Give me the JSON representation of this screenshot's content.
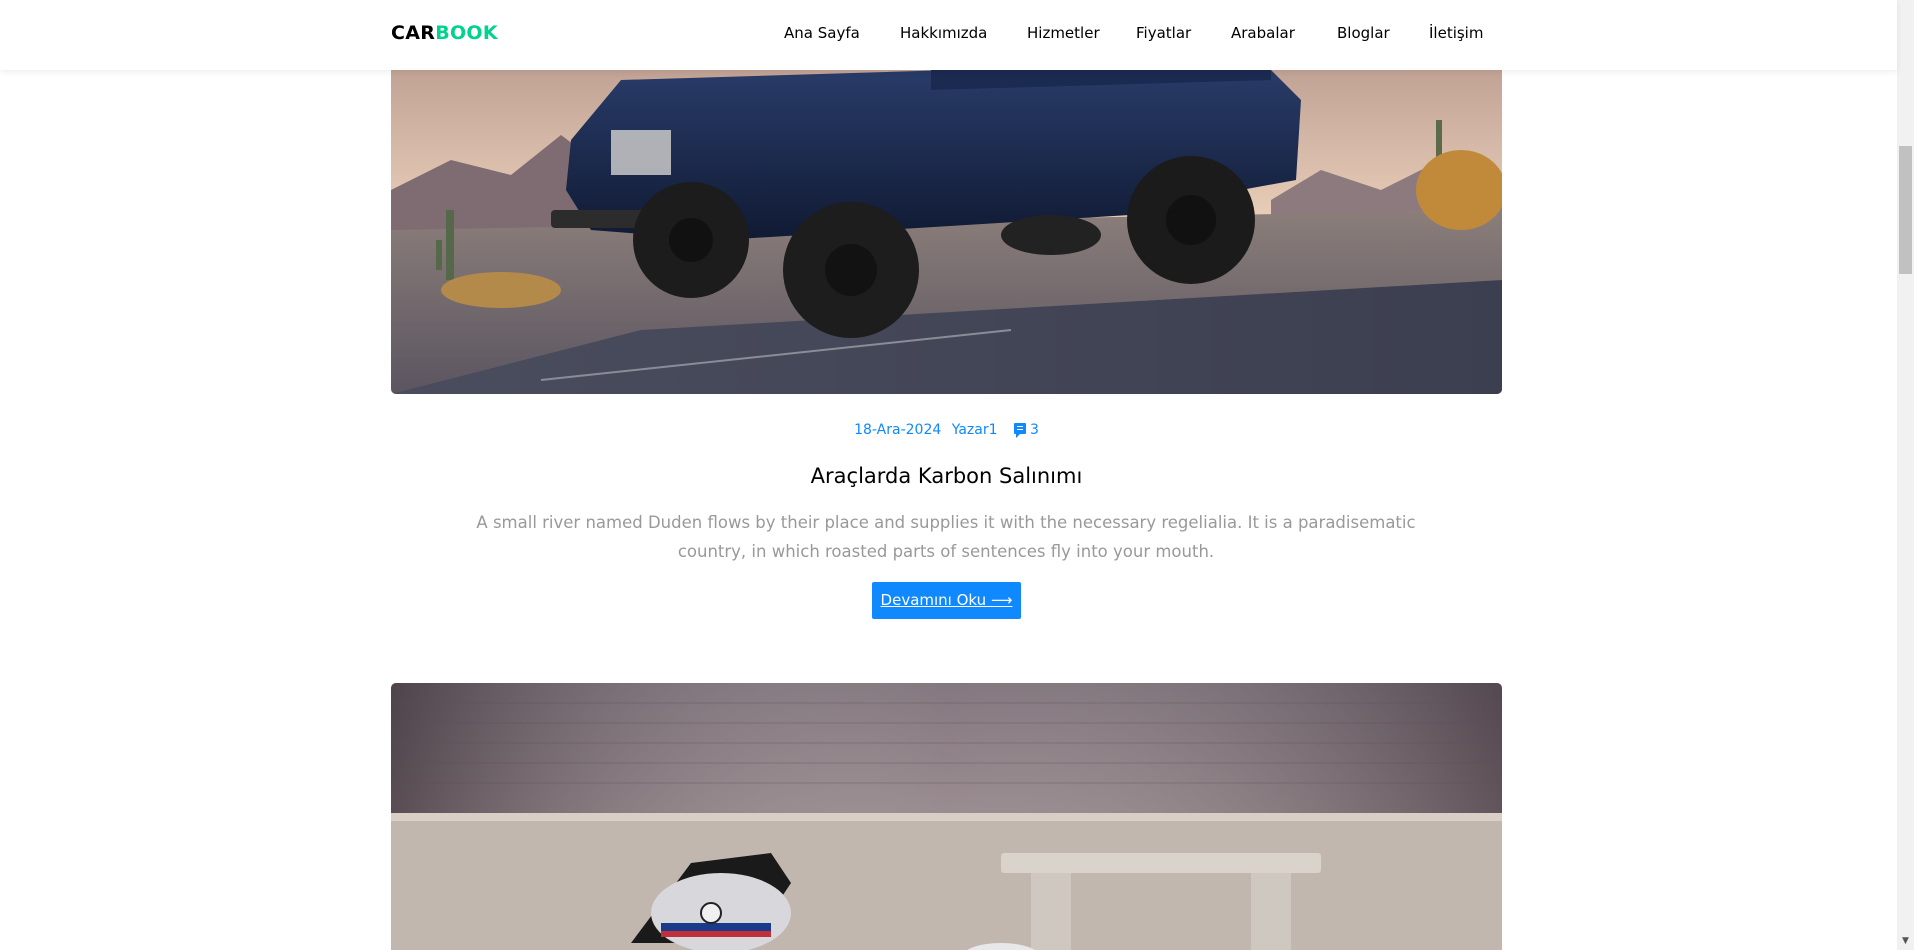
{
  "brand": {
    "part1": "CAR",
    "part2": "BOOK"
  },
  "nav": [
    {
      "label": "Ana Sayfa"
    },
    {
      "label": "Hakkımızda"
    },
    {
      "label": "Hizmetler"
    },
    {
      "label": "Fiyatlar"
    },
    {
      "label": "Arabalar"
    },
    {
      "label": "Bloglar"
    },
    {
      "label": "İletişim"
    }
  ],
  "post": {
    "date": "18-Ara-2024",
    "author": "Yazar1",
    "comments": "3",
    "title": "Araçlarda Karbon Salınımı",
    "excerpt": "A small river named Duden flows by their place and supplies it with the necessary regelialia. It is a paradisematic country, in which roasted parts of sentences fly into your mouth.",
    "button": "Devamını Oku ⟶"
  },
  "colors": {
    "accent": "#1089ff",
    "brand_green": "#01d28e"
  },
  "icons": {
    "comment": "comment-icon"
  }
}
